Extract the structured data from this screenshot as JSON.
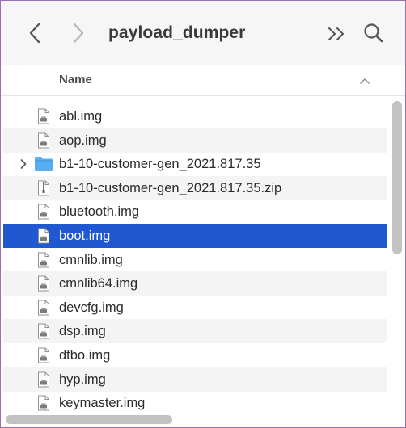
{
  "toolbar": {
    "title": "payload_dumper"
  },
  "columns": {
    "name_label": "Name"
  },
  "files": [
    {
      "name": "abl.img",
      "icon": "document-icon"
    },
    {
      "name": "aop.img",
      "icon": "document-icon"
    },
    {
      "name": "b1-10-customer-gen_2021.817.35",
      "icon": "folder-icon"
    },
    {
      "name": "b1-10-customer-gen_2021.817.35.zip",
      "icon": "zip-icon"
    },
    {
      "name": "bluetooth.img",
      "icon": "document-icon"
    },
    {
      "name": "boot.img",
      "icon": "document-icon"
    },
    {
      "name": "cmnlib.img",
      "icon": "document-icon"
    },
    {
      "name": "cmnlib64.img",
      "icon": "document-icon"
    },
    {
      "name": "devcfg.img",
      "icon": "document-icon"
    },
    {
      "name": "dsp.img",
      "icon": "document-icon"
    },
    {
      "name": "dtbo.img",
      "icon": "document-icon"
    },
    {
      "name": "hyp.img",
      "icon": "document-icon"
    },
    {
      "name": "keymaster.img",
      "icon": "document-icon"
    }
  ],
  "selected_file": "boot.img",
  "colors": {
    "selection": "#2058d2",
    "folder": "#5aaef0",
    "window_border": "#9b6fb3"
  }
}
